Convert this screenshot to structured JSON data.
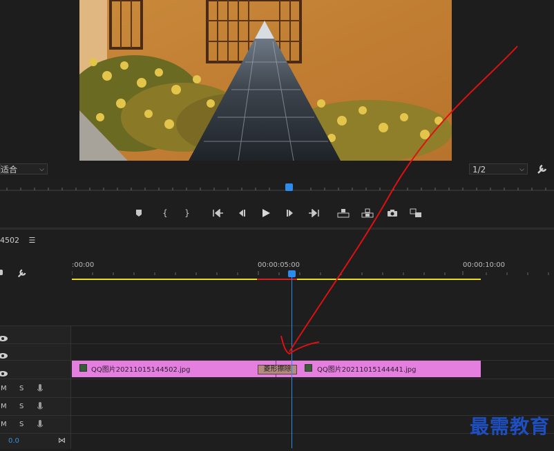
{
  "monitor": {
    "fit_select": "适合",
    "resolution_select": "1/2",
    "timecode_left_partial": "0.0"
  },
  "transport": {
    "buttons": [
      "add-marker",
      "mark-in",
      "mark-out",
      "go-to-in",
      "step-back",
      "play",
      "step-forward",
      "go-to-out",
      "lift",
      "extract",
      "export-frame",
      "compare"
    ]
  },
  "timeline": {
    "sequence_name": "4502",
    "timecodes": [
      ":00:00",
      "00:00:05:00",
      "00:00:10:00"
    ],
    "clips": [
      {
        "label": "QQ图片20211015144502.jpg"
      },
      {
        "label": "QQ图片20211015144441.jpg"
      }
    ],
    "transition_label": "菱形擦除",
    "audio_tracks": [
      {
        "m": "M",
        "s": "S"
      },
      {
        "m": "M",
        "s": "S"
      },
      {
        "m": "M",
        "s": "S"
      }
    ],
    "playhead_timecode": "0.0"
  },
  "watermark": "最需教育",
  "colors": {
    "clip": "#e47fe0",
    "playhead": "#2d8ceb",
    "work_area": "#e8e020",
    "render_red": "#d42020",
    "annotation": "#e01010"
  }
}
